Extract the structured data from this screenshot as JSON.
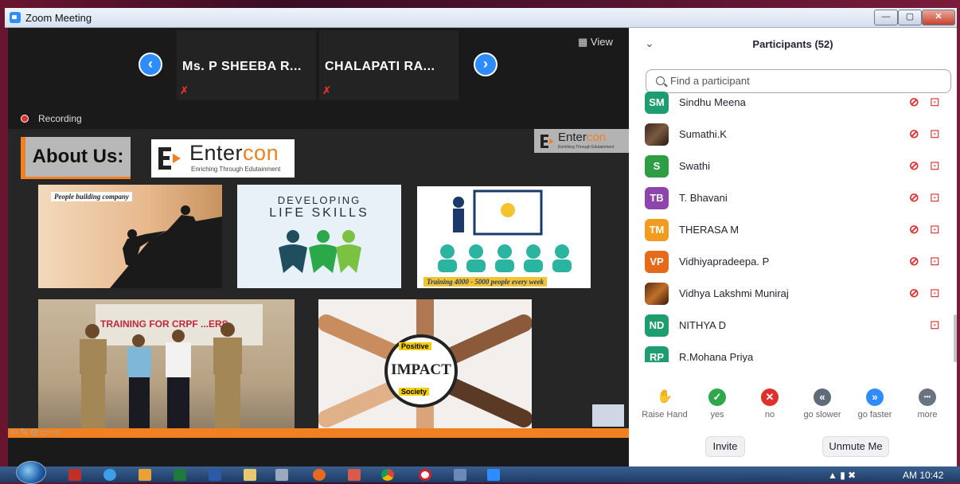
{
  "window": {
    "title": "Zoom Meeting",
    "minimize": "—",
    "maximize": "▢",
    "close": "✕"
  },
  "top_strip": {
    "participants": [
      {
        "name": "Ms. P SHEEBA R...",
        "mic": "✗"
      },
      {
        "name": "CHALAPATI RA...",
        "mic": "✗"
      }
    ],
    "prev": "‹",
    "next": "›",
    "view_label": "View"
  },
  "recording_label": "Recording",
  "slide": {
    "heading": "About Us:",
    "brand_main": "Enter",
    "brand_accent": "con",
    "brand_tagline": "Enriching Through Edutainment",
    "pic1_caption": "People building company",
    "pic2_line1": "DEVELOPING",
    "pic2_line2": "LIFE SKILLS",
    "pic3_caption": "Training 4000 - 5000 people every week",
    "pic4_banner": "TRAINING FOR CRPF ...ERS",
    "impact_top": "Positive",
    "impact_main": "IMPACT",
    "impact_bottom": "Society",
    "controls": "⇦✎⊖▭⇨"
  },
  "panel": {
    "collapse_icon": "⌄",
    "title": "Participants (52)",
    "search_placeholder": "Find a participant",
    "participants": [
      {
        "initials": "SM",
        "name": "Sindhu Meena",
        "color": "#1e9e6e",
        "mic_off": true,
        "video_off": true
      },
      {
        "initials": "",
        "name": "Sumathi.K",
        "color": "",
        "photo": true,
        "mic_off": true,
        "video_off": true
      },
      {
        "initials": "S",
        "name": "Swathi",
        "color": "#2e9e45",
        "mic_off": true,
        "video_off": true
      },
      {
        "initials": "TB",
        "name": "T. Bhavani",
        "color": "#8e44ad",
        "mic_off": true,
        "video_off": true
      },
      {
        "initials": "TM",
        "name": "THERASA M",
        "color": "#f29c1f",
        "mic_off": true,
        "video_off": true
      },
      {
        "initials": "VP",
        "name": "Vidhiyapradeepa. P",
        "color": "#e56a1b",
        "mic_off": true,
        "video_off": true
      },
      {
        "initials": "",
        "name": "Vidhya Lakshmi Muniraj",
        "color": "",
        "photo": true,
        "mic_off": true,
        "video_off": true
      },
      {
        "initials": "ND",
        "name": "NITHYA D",
        "color": "#1e9e6e",
        "mic_off": false,
        "video_off": true
      },
      {
        "initials": "RP",
        "name": "R.Mohana Priya",
        "color": "#1e9e6e",
        "mic_off": false,
        "video_off": false
      }
    ],
    "reactions": [
      {
        "label": "Raise Hand",
        "glyph": "✋",
        "color": "#2d8cff"
      },
      {
        "label": "yes",
        "glyph": "✓",
        "color": "#2ea84a"
      },
      {
        "label": "no",
        "glyph": "✕",
        "color": "#e0302b"
      },
      {
        "label": "go slower",
        "glyph": "«",
        "color": "#5f6a7a"
      },
      {
        "label": "go faster",
        "glyph": "»",
        "color": "#2d8cff"
      },
      {
        "label": "more",
        "glyph": "•••",
        "color": "#6b7280"
      }
    ],
    "invite_label": "Invite",
    "unmute_label": "Unmute Me"
  },
  "taskbar": {
    "apps": [
      "acrobat",
      "ie",
      "media",
      "excel",
      "word",
      "folder",
      "calc",
      "firefox",
      "paint",
      "chrome",
      "opera",
      "explorer",
      "zoom"
    ],
    "tray": "▲  ▮  ✖",
    "clock": "AM 10:42"
  }
}
